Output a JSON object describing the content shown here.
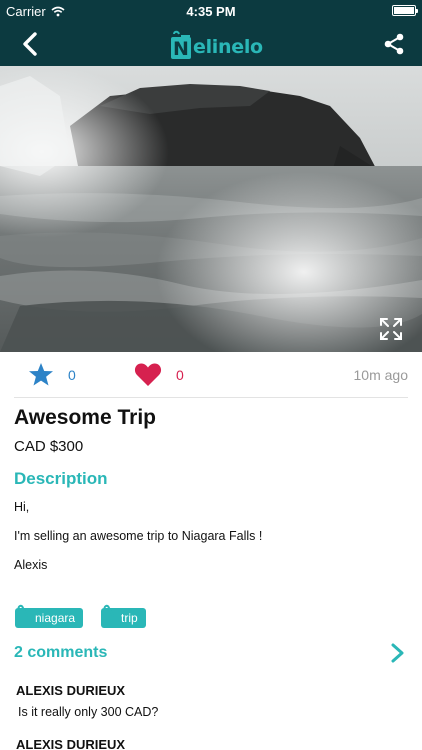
{
  "status_bar": {
    "carrier": "Carrier",
    "time": "4:35 PM"
  },
  "nav": {
    "logo_text": "elinelo",
    "logo_mark": "N"
  },
  "listing": {
    "title": "Awesome Trip",
    "price": "CAD $300",
    "favorites_count": "0",
    "likes_count": "0",
    "posted": "10m ago"
  },
  "description": {
    "heading": "Description",
    "lines": [
      "Hi,",
      "I'm selling an awesome trip to Niagara Falls !",
      "Alexis"
    ]
  },
  "tags": [
    "niagara",
    "trip"
  ],
  "comments": {
    "heading": "2 comments",
    "items": [
      {
        "author": "ALEXIS DURIEUX",
        "text": "Is it really only 300 CAD?"
      },
      {
        "author": "ALEXIS DURIEUX",
        "text": ""
      }
    ]
  },
  "colors": {
    "bar": "#0c3a40",
    "accent": "#2ab7b7",
    "star": "#2d83c7",
    "heart": "#d6214f"
  },
  "icons": [
    "back-icon",
    "share-icon",
    "expand-icon",
    "star-icon",
    "heart-icon",
    "tag-icon",
    "chevron-right-icon",
    "wifi-icon",
    "battery-icon"
  ]
}
